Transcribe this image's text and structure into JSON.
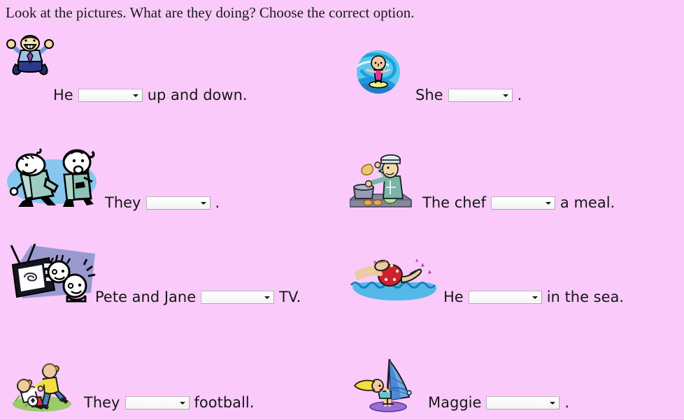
{
  "page": {
    "background_color": "#facbfa",
    "title": "Look at the pictures. What are they doing? Choose the correct option."
  },
  "exercises": [
    {
      "id": "q1",
      "picture_name": "man-jumping-clipart",
      "prefix": "He",
      "suffix": "up and down.",
      "dropdown_value": "",
      "dropdown_width": 92
    },
    {
      "id": "q2",
      "picture_name": "girl-surfing-clipart",
      "prefix": "She",
      "suffix": ".",
      "dropdown_value": "",
      "dropdown_width": 92
    },
    {
      "id": "q3",
      "picture_name": "couple-dancing-singing-clipart",
      "prefix": "They",
      "suffix": ".",
      "dropdown_value": "",
      "dropdown_width": 92
    },
    {
      "id": "q4",
      "picture_name": "chef-cooking-clipart",
      "prefix": "The chef",
      "suffix": "a meal.",
      "dropdown_value": "",
      "dropdown_width": 92
    },
    {
      "id": "q5",
      "picture_name": "children-watching-tv-clipart",
      "prefix": "Pete and Jane",
      "suffix": "TV.",
      "dropdown_value": "",
      "dropdown_width": 105
    },
    {
      "id": "q6",
      "picture_name": "man-swimming-clipart",
      "prefix": "He",
      "suffix": "in the sea.",
      "dropdown_value": "",
      "dropdown_width": 105
    },
    {
      "id": "q7",
      "picture_name": "children-playing-football-clipart",
      "prefix": "They",
      "suffix": "football.",
      "dropdown_value": "",
      "dropdown_width": 92
    },
    {
      "id": "q8",
      "picture_name": "girl-windsurfing-clipart",
      "prefix": "Maggie",
      "suffix": ".",
      "dropdown_value": "",
      "dropdown_width": 105
    }
  ],
  "icons": {
    "dropdown_arrow": "chevron-down-icon"
  }
}
